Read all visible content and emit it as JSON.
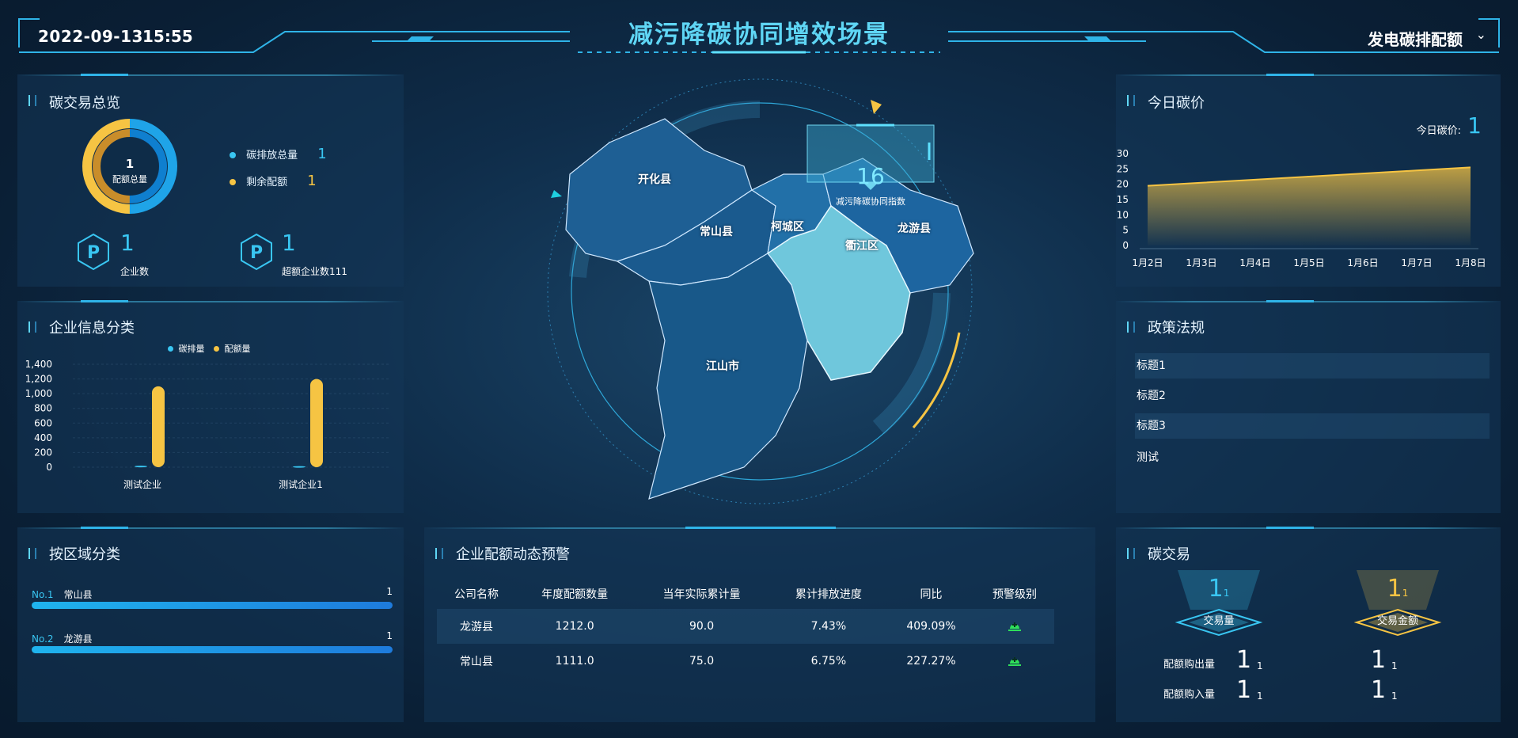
{
  "header": {
    "date": "2022-09-13",
    "time": "15:55",
    "title": "减污降碳协同增效场景",
    "selector_value": "发电碳排配额",
    "selector_icon": "chevron-down-icon"
  },
  "carbon_overview": {
    "title": "碳交易总览",
    "donut_value": "1",
    "donut_label": "配额总量",
    "legend": [
      {
        "label": "碳排放总量",
        "value": "1",
        "color": "#39c6f2"
      },
      {
        "label": "剩余配额",
        "value": "1",
        "color": "#f6c443"
      }
    ],
    "stats": [
      {
        "icon": "parking-hexagon-icon",
        "value": "1",
        "label": "企业数"
      },
      {
        "icon": "parking-hexagon-icon",
        "value": "1",
        "label": "超额企业数111"
      }
    ]
  },
  "enterprise_class": {
    "title": "企业信息分类",
    "chart_data": {
      "type": "bar",
      "categories": [
        "测试企业",
        "测试企业1"
      ],
      "series": [
        {
          "name": "碳排量",
          "values": [
            20,
            15
          ],
          "color": "#39c6f2"
        },
        {
          "name": "配额量",
          "values": [
            1100,
            1200
          ],
          "color": "#f6c443"
        }
      ],
      "yticks": [
        "1,400",
        "1,200",
        "1,000",
        "800",
        "600",
        "400",
        "200",
        "0"
      ],
      "ylim": [
        0,
        1400
      ],
      "legend_position": "top"
    }
  },
  "region_class": {
    "title": "按区域分类",
    "items": [
      {
        "rank": "No.1",
        "name": "常山县",
        "value": "1",
        "fraction": 1.0
      },
      {
        "rank": "No.2",
        "name": "龙游县",
        "value": "1",
        "fraction": 1.0
      }
    ]
  },
  "map": {
    "index_value": "16",
    "index_label": "减污降碳协同指数",
    "regions": [
      "开化县",
      "常山县",
      "柯城区",
      "衢江区",
      "龙游县",
      "江山市"
    ]
  },
  "warning": {
    "title": "企业配额动态预警",
    "columns": [
      "公司名称",
      "年度配额数量",
      "当年实际累计量",
      "累计排放进度",
      "同比",
      "预警级别"
    ],
    "rows": [
      {
        "name": "龙游县",
        "quota": "1212.0",
        "actual": "90.0",
        "progress": "7.43%",
        "yoy": "409.09%",
        "level_icon": "green-alert-icon"
      },
      {
        "name": "常山县",
        "quota": "1111.0",
        "actual": "75.0",
        "progress": "6.75%",
        "yoy": "227.27%",
        "level_icon": "green-alert-icon"
      }
    ]
  },
  "carbon_price": {
    "title": "今日碳价",
    "today_label": "今日碳价:",
    "today_value": "1",
    "chart_data": {
      "type": "area",
      "categories": [
        "1月2日",
        "1月3日",
        "1月4日",
        "1月5日",
        "1月6日",
        "1月7日",
        "1月8日"
      ],
      "values": [
        19.5,
        20.5,
        21.5,
        22.5,
        23.5,
        24.5,
        25.5
      ],
      "yticks": [
        "30",
        "25",
        "20",
        "15",
        "10",
        "5",
        "0"
      ],
      "ylim": [
        0,
        30
      ],
      "color": "#f6c443"
    }
  },
  "policy": {
    "title": "政策法规",
    "items": [
      "标题1",
      "标题2",
      "标题3",
      "测试"
    ]
  },
  "carbon_trade": {
    "title": "碳交易",
    "blocks": [
      {
        "value": "1",
        "sub": "1",
        "label": "交易量",
        "color": "#39c6f2"
      },
      {
        "value": "1",
        "sub": "1",
        "label": "交易金额",
        "color": "#f6c443"
      }
    ],
    "rows": [
      {
        "label": "配额购出量",
        "v1": "1",
        "s1": "1",
        "v2": "1",
        "s2": "1"
      },
      {
        "label": "配额购入量",
        "v1": "1",
        "s1": "1",
        "v2": "1",
        "s2": "1"
      }
    ]
  }
}
